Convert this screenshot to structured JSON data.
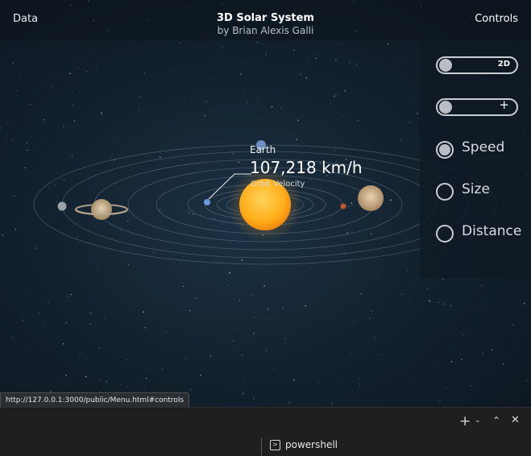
{
  "header": {
    "left_link": "Data",
    "title": "3D Solar System",
    "subtitle": "by Brian Alexis Galli",
    "right_link": "Controls"
  },
  "controls": {
    "toggle_view_label": "2D",
    "toggle_zoom_label": "+",
    "radio_speed": "Speed",
    "radio_size": "Size",
    "radio_distance": "Distance",
    "selected": "Speed"
  },
  "planet_info": {
    "name": "Earth",
    "speed": "107,218 km/h",
    "caption": "Orbit Velocity"
  },
  "statusbar": {
    "url": "http://127.0.0.1:3000/public/Menu.html#controls"
  },
  "terminal": {
    "new_icon": "plus-icon",
    "dropdown_icon": "chevron-down-icon",
    "maximize_icon": "chevron-up-icon",
    "close_icon": "close-icon",
    "shell_label": "powershell"
  },
  "colors": {
    "sun": "#ffb21f",
    "background": "#13222f",
    "panel": "#101a24"
  }
}
